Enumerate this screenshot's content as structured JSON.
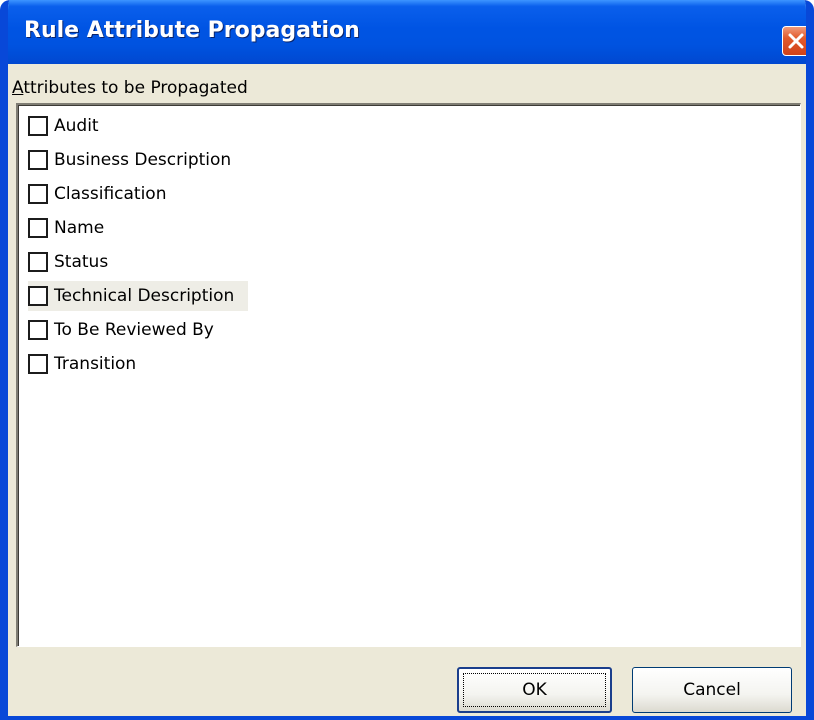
{
  "dialog": {
    "title": "Rule Attribute Propagation",
    "group_label_accel": "A",
    "group_label_rest": "ttributes to be Propagated",
    "items": [
      {
        "label": "Audit",
        "checked": false
      },
      {
        "label": "Business Description",
        "checked": false
      },
      {
        "label": "Classification",
        "checked": false
      },
      {
        "label": "Name",
        "checked": false
      },
      {
        "label": "Status",
        "checked": false
      },
      {
        "label": "Technical Description",
        "checked": false
      },
      {
        "label": "To Be Reviewed By",
        "checked": false
      },
      {
        "label": "Transition",
        "checked": false
      }
    ],
    "ok_label": "OK",
    "cancel_label": "Cancel"
  },
  "icons": {
    "close": "close-icon"
  },
  "colors": {
    "titlebar": "#0054e3",
    "close_button": "#e25a2c",
    "dialog_background": "#ece9d8",
    "hover_row": "#eeede6"
  }
}
